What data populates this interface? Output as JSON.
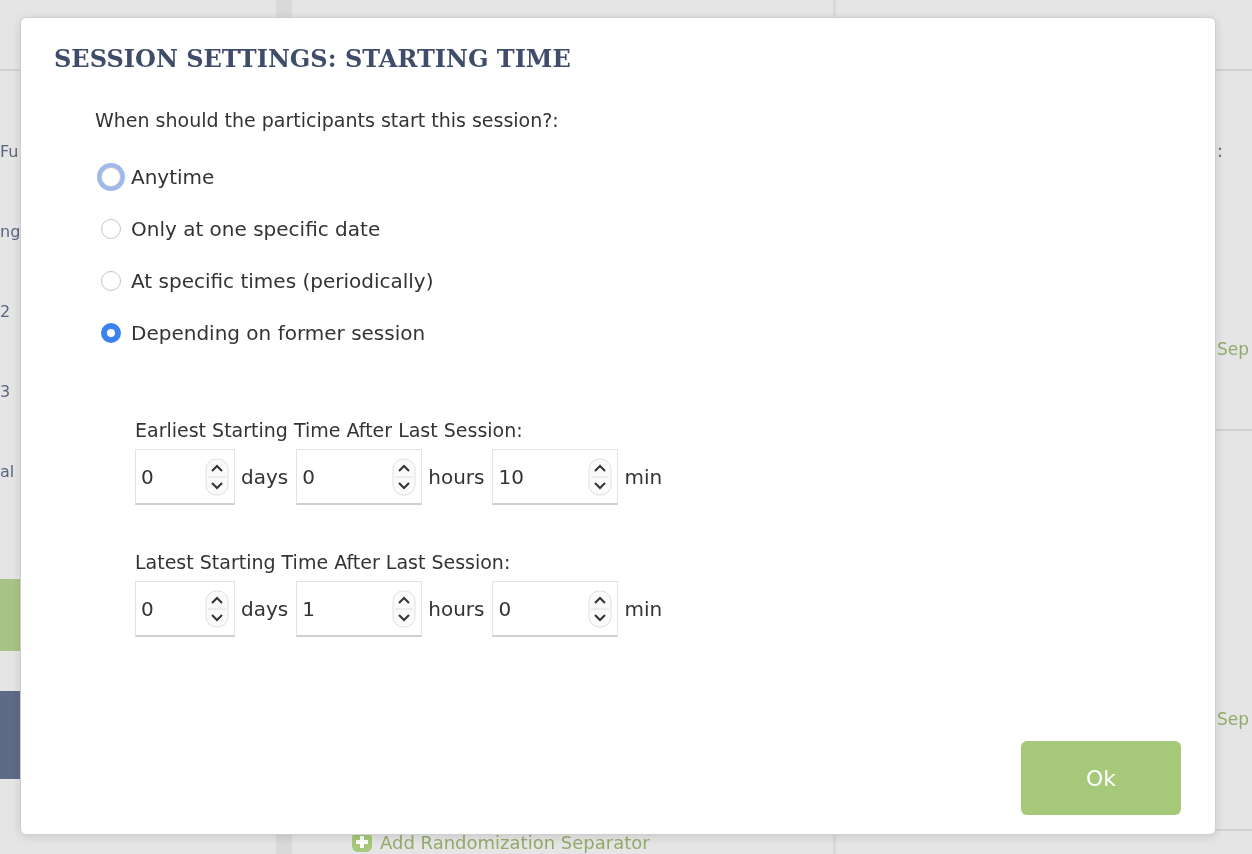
{
  "background": {
    "left_fragments": [
      "Fu",
      "ng",
      "2",
      "3",
      "al"
    ],
    "right_fragments": [
      {
        "text": ":",
        "kind": "label"
      },
      {
        "text": "Sep",
        "kind": "link"
      },
      {
        "text": "Sep",
        "kind": "link"
      }
    ],
    "add_link": "Add Randomization Separator"
  },
  "dialog": {
    "title": "SESSION SETTINGS: STARTING TIME",
    "question": "When should the participants start this session?:",
    "options": [
      {
        "label": "Anytime",
        "selected": false,
        "focused": true
      },
      {
        "label": "Only at one specific date",
        "selected": false,
        "focused": false
      },
      {
        "label": "At specific times (periodically)",
        "selected": false,
        "focused": false
      },
      {
        "label": "Depending on former session",
        "selected": true,
        "focused": false
      }
    ],
    "ranges": [
      {
        "label": "Earliest Starting Time After Last Session:",
        "fields": [
          {
            "value": "0",
            "unit": "days"
          },
          {
            "value": "0",
            "unit": "hours"
          },
          {
            "value": "10",
            "unit": "min"
          }
        ]
      },
      {
        "label": "Latest Starting Time After Last Session:",
        "fields": [
          {
            "value": "0",
            "unit": "days"
          },
          {
            "value": "1",
            "unit": "hours"
          },
          {
            "value": "0",
            "unit": "min"
          }
        ]
      }
    ],
    "buttons": [
      {
        "label": "Ok"
      }
    ]
  }
}
